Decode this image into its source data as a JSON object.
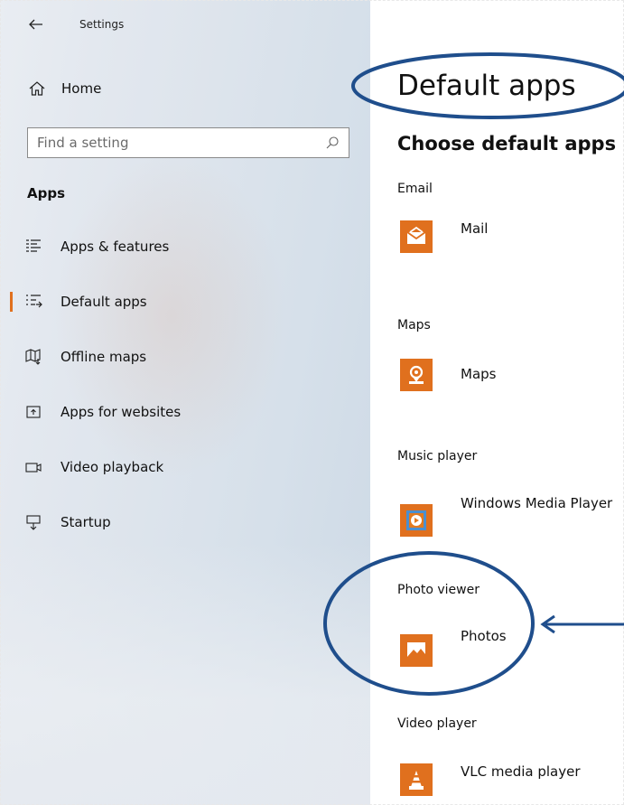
{
  "window": {
    "title": "Settings"
  },
  "sidebar": {
    "home_label": "Home",
    "search": {
      "placeholder": "Find a setting"
    },
    "section_heading": "Apps",
    "items": [
      {
        "label": "Apps & features",
        "icon": "apps-features-icon"
      },
      {
        "label": "Default apps",
        "icon": "default-apps-icon",
        "selected": true
      },
      {
        "label": "Offline maps",
        "icon": "offline-maps-icon"
      },
      {
        "label": "Apps for websites",
        "icon": "apps-for-websites-icon"
      },
      {
        "label": "Video playback",
        "icon": "video-playback-icon"
      },
      {
        "label": "Startup",
        "icon": "startup-icon"
      }
    ]
  },
  "main": {
    "title": "Default apps",
    "subtitle": "Choose default apps",
    "categories": [
      {
        "label": "Email",
        "app": "Mail",
        "icon": "mail-icon"
      },
      {
        "label": "Maps",
        "app": "Maps",
        "icon": "maps-icon"
      },
      {
        "label": "Music player",
        "app": "Windows Media Player",
        "icon": "windows-media-player-icon"
      },
      {
        "label": "Photo viewer",
        "app": "Photos",
        "icon": "photos-icon"
      },
      {
        "label": "Video player",
        "app": "VLC media player",
        "icon": "vlc-icon"
      }
    ]
  },
  "colors": {
    "accent": "#e0701e",
    "annotation": "#1f4e8c",
    "sidebar_bg": "#dde4ec"
  }
}
